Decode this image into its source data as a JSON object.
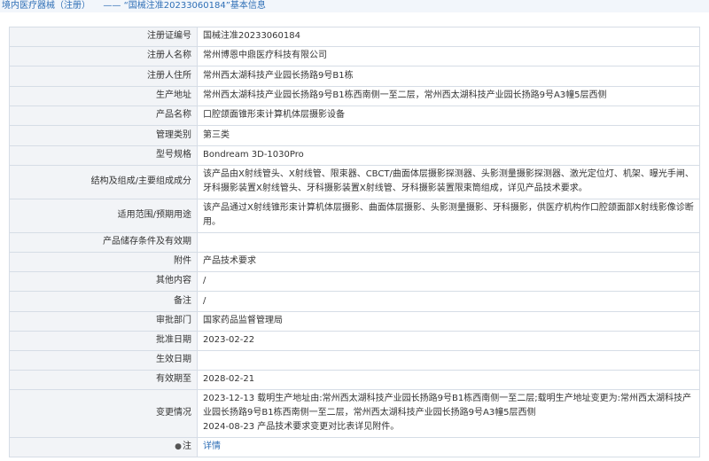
{
  "breadcrumb": {
    "section": "境内医疗器械（注册）",
    "separator": "——",
    "title": "“国械注准20233060184”基本信息"
  },
  "rows": [
    {
      "key": "注册证编号",
      "value": "国械注准20233060184"
    },
    {
      "key": "注册人名称",
      "value": "常州博恩中鼎医疗科技有限公司"
    },
    {
      "key": "注册人住所",
      "value": "常州西太湖科技产业园长扬路9号B1栋"
    },
    {
      "key": "生产地址",
      "value": "常州西太湖科技产业园长扬路9号B1栋西南侧一至二层，常州西太湖科技产业园长扬路9号A3幢5层西侧"
    },
    {
      "key": "产品名称",
      "value": "口腔颌面锥形束计算机体层摄影设备"
    },
    {
      "key": "管理类别",
      "value": "第三类"
    },
    {
      "key": "型号规格",
      "value": "Bondream 3D-1030Pro"
    },
    {
      "key": "结构及组成/主要组成成分",
      "value": "该产品由X射线管头、X射线管、限束器、CBCT/曲面体层摄影探测器、头影测量摄影探测器、激光定位灯、机架、曝光手闸、牙科摄影装置X射线管头、牙科摄影装置X射线管、牙科摄影装置限束筒组成，详见产品技术要求。"
    },
    {
      "key": "适用范围/预期用途",
      "value": "该产品通过X射线锥形束计算机体层摄影、曲面体层摄影、头影测量摄影、牙科摄影，供医疗机构作口腔颌面部X射线影像诊断用。"
    },
    {
      "key": "产品储存条件及有效期",
      "value": ""
    },
    {
      "key": "附件",
      "value": "产品技术要求"
    },
    {
      "key": "其他内容",
      "value": "/"
    },
    {
      "key": "备注",
      "value": "/"
    },
    {
      "key": "审批部门",
      "value": "国家药品监督管理局"
    },
    {
      "key": "批准日期",
      "value": "2023-02-22"
    },
    {
      "key": "生效日期",
      "value": ""
    },
    {
      "key": "有效期至",
      "value": "2028-02-21"
    }
  ],
  "changes": {
    "key": "变更情况",
    "line1": "2023-12-13 载明生产地址由:常州西太湖科技产业园长扬路9号B1栋西南侧一至二层;载明生产地址变更为:常州西太湖科技产业园长扬路9号B1栋西南侧一至二层，常州西太湖科技产业园长扬路9号A3幢5层西侧",
    "line2": "2024-08-23 产品技术要求变更对比表详见附件。"
  },
  "footer_row": {
    "key": "注",
    "icon": "pin-icon",
    "link": "详情"
  }
}
